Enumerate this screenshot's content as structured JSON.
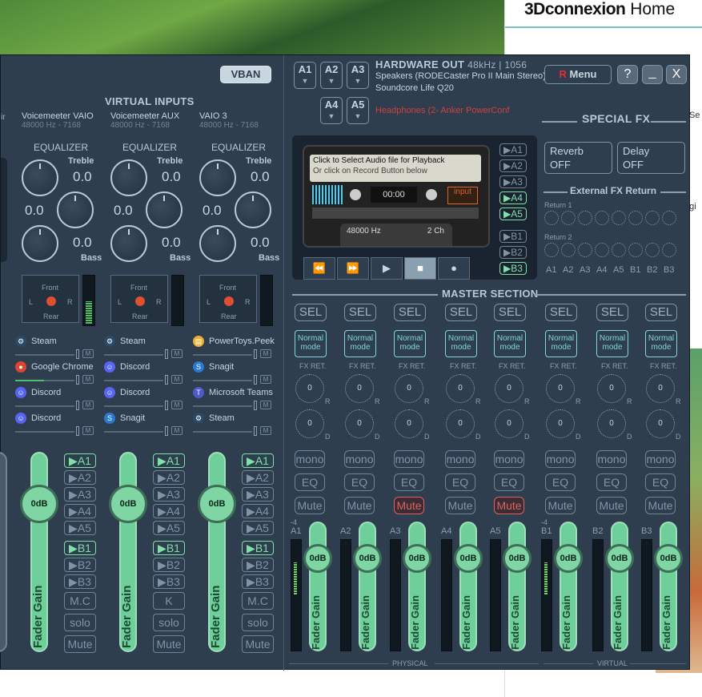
{
  "background": {
    "site_title_bold": "3Dconnexion",
    "site_title_rest": " Home",
    "right_peek_1": "Se",
    "right_peek_2": "egi"
  },
  "titlebar": {
    "vban": "VBAN",
    "menu": "Menu",
    "help": "?",
    "minimize": "_",
    "close": "X",
    "hw_title": "HARDWARE OUT",
    "hw_rate": "48kHz | 1056",
    "hw_dev1": "Speakers (RODECaster Pro II Main Stereo)",
    "hw_dev2": "Soundcore Life Q20",
    "hw_dev3": "Headphones (2- Anker PowerConf",
    "a_buttons": [
      "A1",
      "A2",
      "A3",
      "A4",
      "A5"
    ]
  },
  "virtual_inputs": {
    "title": "VIRTUAL INPUTS",
    "partial_left": "ir",
    "strips": [
      {
        "name": "Voicemeeter VAIO",
        "rate": "48000 Hz - 7168",
        "eq": "EQUALIZER",
        "treble": "Treble",
        "tval": "0.0",
        "mid": "0.0",
        "bass": "Bass",
        "bval": "0.0",
        "apps": [
          {
            "name": "Steam",
            "icon": "steam-icon"
          },
          {
            "name": "Google Chrome",
            "icon": "chrome-icon"
          },
          {
            "name": "Discord",
            "icon": "discord-icon"
          },
          {
            "name": "Discord",
            "icon": "discord-icon"
          }
        ]
      },
      {
        "name": "Voicemeeter AUX",
        "rate": "48000 Hz - 7168",
        "eq": "EQUALIZER",
        "treble": "Treble",
        "tval": "0.0",
        "mid": "0.0",
        "bass": "Bass",
        "bval": "0.0",
        "apps": [
          {
            "name": "Steam",
            "icon": "steam-icon"
          },
          {
            "name": "Discord",
            "icon": "discord-icon"
          },
          {
            "name": "Discord",
            "icon": "discord-icon"
          },
          {
            "name": "Snagit",
            "icon": "snagit-icon"
          }
        ]
      },
      {
        "name": "VAIO 3",
        "rate": "48000 Hz - 7168",
        "eq": "EQUALIZER",
        "treble": "Treble",
        "tval": "0.0",
        "mid": "0.0",
        "bass": "Bass",
        "bval": "0.0",
        "apps": [
          {
            "name": "PowerToys.Peek",
            "icon": "folder-icon"
          },
          {
            "name": "Snagit",
            "icon": "snagit-icon"
          },
          {
            "name": "Microsoft Teams",
            "icon": "teams-icon"
          },
          {
            "name": "Steam",
            "icon": "steam-icon"
          }
        ]
      }
    ],
    "pan_front": "Front",
    "pan_rear": "Rear",
    "pan_l": "L",
    "pan_r": "R",
    "mute_small": "M",
    "bus_labels": [
      "▶A1",
      "▶A2",
      "▶A3",
      "▶A4",
      "▶A5",
      "▶B1",
      "▶B2",
      "▶B3"
    ],
    "mc": "M.C",
    "k": "K",
    "solo": "solo",
    "mute": "Mute",
    "fader_db": "0dB",
    "fader_label": "Fader Gain"
  },
  "player": {
    "line1": "Click to Select Audio file for Playback",
    "line2": "Or click on Record Button below",
    "time": "00:00",
    "input": "input",
    "hz": "48000 Hz",
    "ch": "2 Ch",
    "route": [
      "▶A1",
      "▶A2",
      "▶A3",
      "▶A4",
      "▶A5",
      "▶B1",
      "▶B2",
      "▶B3"
    ]
  },
  "special_fx": {
    "title": "SPECIAL FX",
    "reverb": "Reverb",
    "reverb_state": "OFF",
    "delay": "Delay",
    "delay_state": "OFF",
    "ext_title": "External FX Return",
    "return1": "Return 1",
    "return2": "Return 2",
    "bus_names": [
      "A1",
      "A2",
      "A3",
      "A4",
      "A5",
      "B1",
      "B2",
      "B3"
    ]
  },
  "master": {
    "title": "MASTER SECTION",
    "sel": "SEL",
    "mode": "Normal mode",
    "fxret": "FX RET.",
    "knob_val": "0",
    "r": "R",
    "d": "D",
    "mono": "mono",
    "eq": "EQ",
    "mute": "Mute",
    "fader_db": "0dB",
    "fader_label": "Fader Gain",
    "level_top": "-4",
    "buses": [
      "A1",
      "A2",
      "A3",
      "A4",
      "A5",
      "B1",
      "B2",
      "B3"
    ],
    "muted": [
      false,
      false,
      true,
      false,
      true,
      false,
      false,
      false
    ],
    "physical": "PHYSICAL",
    "virtual": "VIRTUAL"
  }
}
